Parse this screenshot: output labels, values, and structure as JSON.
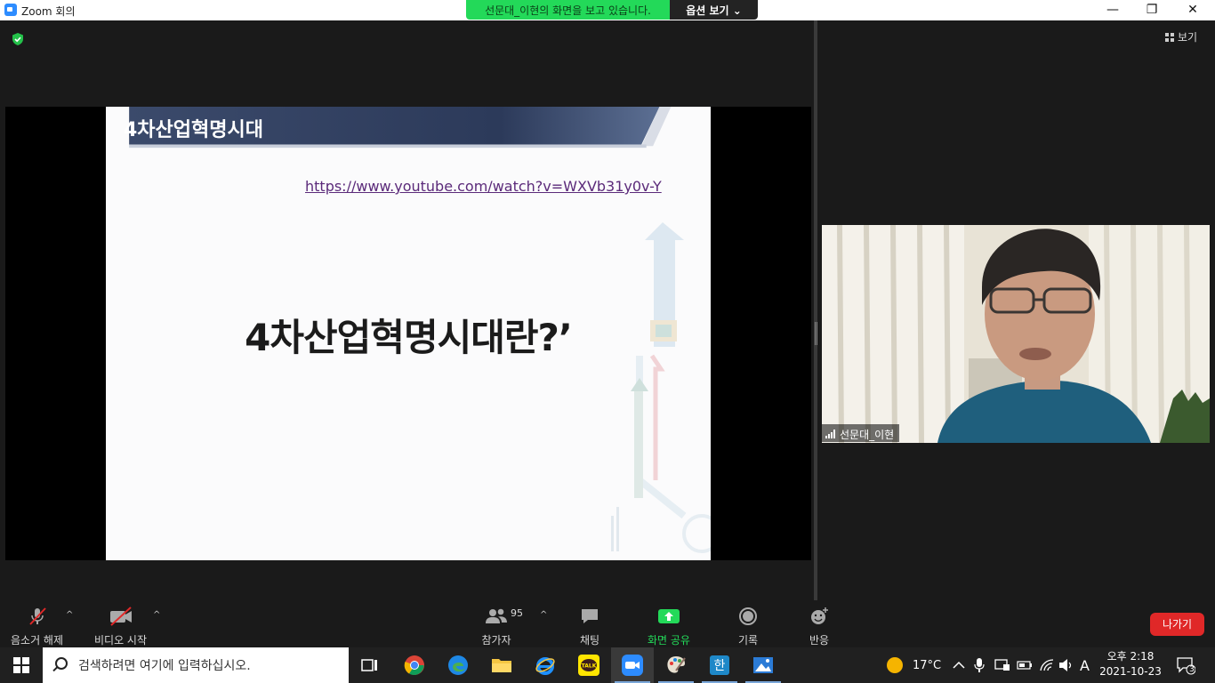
{
  "window": {
    "title": "Zoom 회의",
    "minimize": "—",
    "restore": "❐",
    "close": "✕"
  },
  "share_banner": {
    "message": "선문대_이현의 화면을 보고 있습니다.",
    "options": "옵션 보기 ⌄"
  },
  "view_button": {
    "label": "보기"
  },
  "slide": {
    "title": "4차산업혁명시대",
    "link": "https://www.youtube.com/watch?v=WXVb31y0v-Y",
    "heading": "4차산업혁명시대란?’"
  },
  "participant": {
    "name": "선문대_이현"
  },
  "toolbar": {
    "unmute": "음소거 해제",
    "start_video": "비디오 시작",
    "participants": "참가자",
    "participant_count": "95",
    "chat": "채팅",
    "share_screen": "화면 공유",
    "record": "기록",
    "reactions": "반응",
    "leave": "나가기",
    "caret": "^"
  },
  "taskbar": {
    "search_placeholder": "검색하려면 여기에 입력하십시오.",
    "weather": "17°C",
    "ime": "A",
    "time": "오후 2:18",
    "date": "2021-10-23",
    "notifications": "3",
    "hangul_label": "한",
    "kakao_label": "TALK"
  },
  "colors": {
    "share_green": "#23d959",
    "leave_red": "#e02828",
    "zoom_blue": "#2d8cff"
  }
}
